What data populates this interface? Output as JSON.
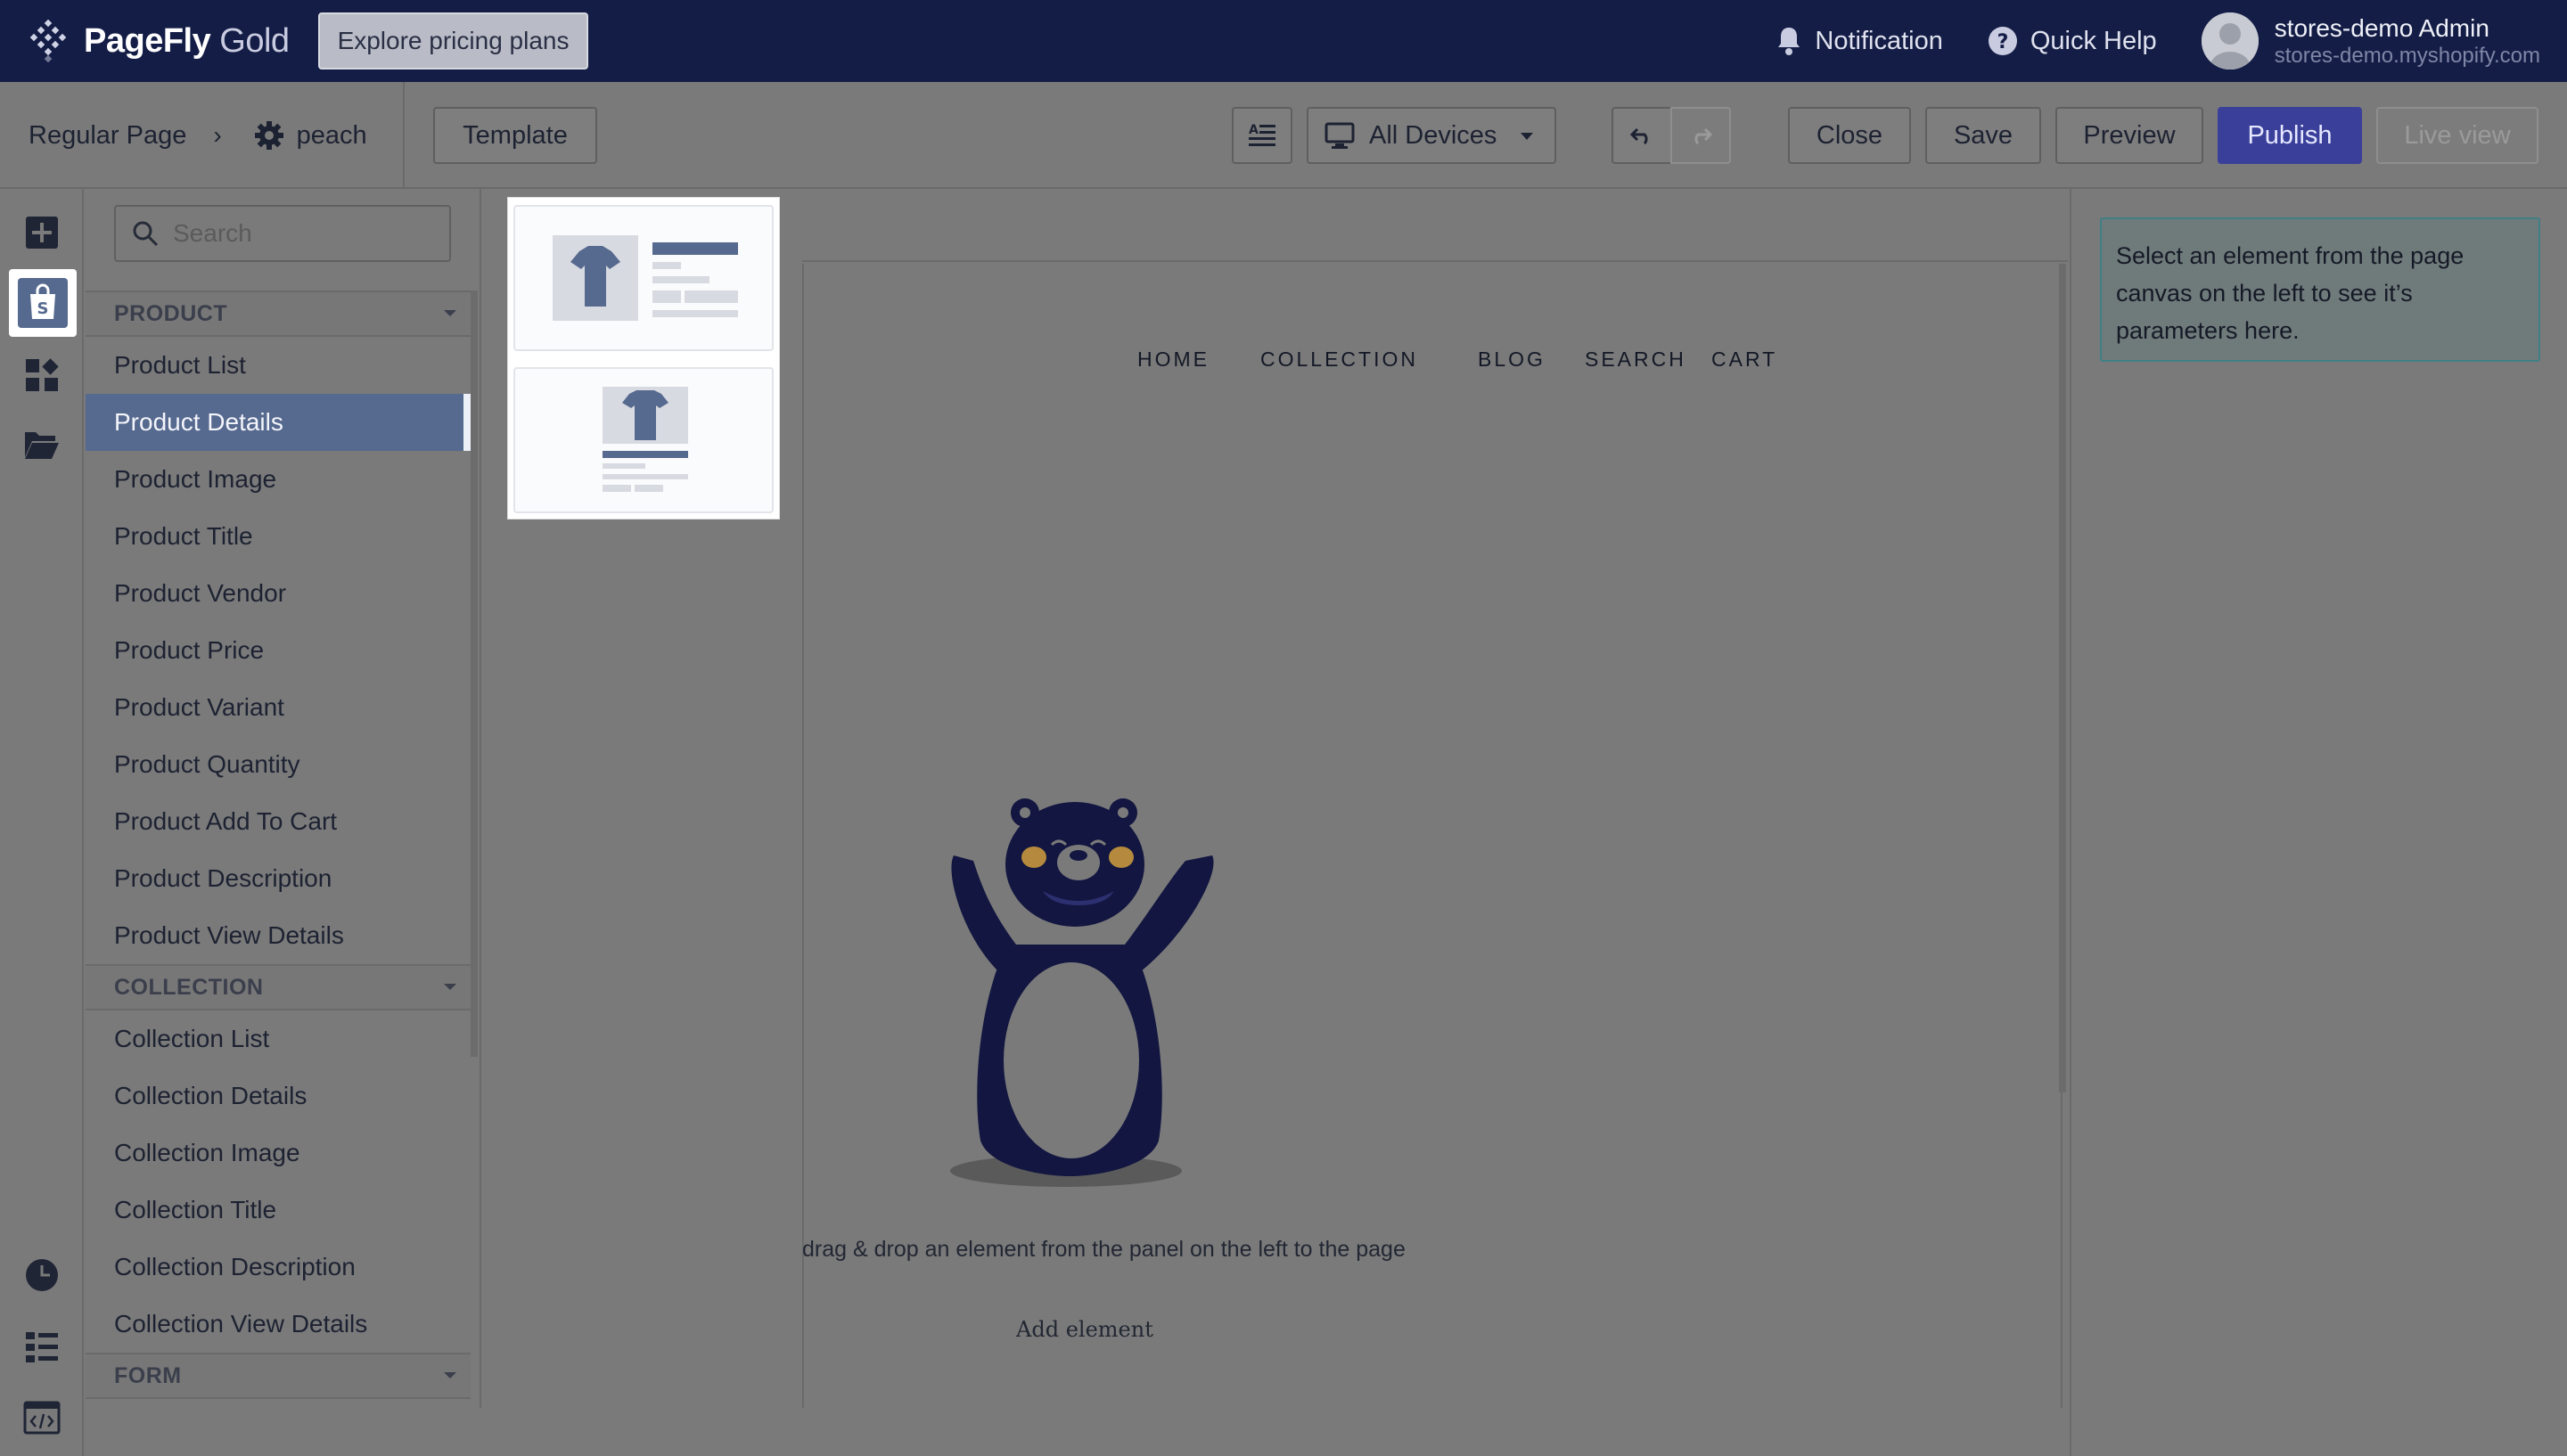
{
  "topbar": {
    "brand_bold": "PageFly",
    "brand_tier": " Gold",
    "pricing_button": "Explore pricing plans",
    "notification_label": "Notification",
    "help_label": "Quick Help",
    "user_name": "stores-demo Admin",
    "user_domain": "stores-demo.myshopify.com"
  },
  "toolbar": {
    "page_type": "Regular Page",
    "page_name": "peach",
    "template_button": "Template",
    "device_selector": "All Devices",
    "close_button": "Close",
    "save_button": "Save",
    "preview_button": "Preview",
    "publish_button": "Publish",
    "live_view_button": "Live view"
  },
  "panel": {
    "search_placeholder": "Search",
    "groups": [
      {
        "title": "PRODUCT",
        "items": [
          "Product List",
          "Product Details",
          "Product Image",
          "Product Title",
          "Product Vendor",
          "Product Price",
          "Product Variant",
          "Product Quantity",
          "Product Add To Cart",
          "Product Description",
          "Product View Details"
        ]
      },
      {
        "title": "COLLECTION",
        "items": [
          "Collection List",
          "Collection Details",
          "Collection Image",
          "Collection Title",
          "Collection Description",
          "Collection View Details"
        ]
      },
      {
        "title": "FORM",
        "items": []
      }
    ],
    "active_item": "Product Details"
  },
  "canvas": {
    "nav": [
      "HOME",
      "COLLECTION",
      "BLOG",
      "SEARCH",
      "CART"
    ],
    "empty_message": "drag & drop an element from the panel on the left to the page",
    "add_element": "Add element"
  },
  "inspector": {
    "hint": "Select an element from the page canvas on the left to see it’s parameters here."
  },
  "colors": {
    "topbar": "#141d46",
    "publish": "#3a3f9a",
    "active_item": "#56698e",
    "mascot": "#121640"
  }
}
